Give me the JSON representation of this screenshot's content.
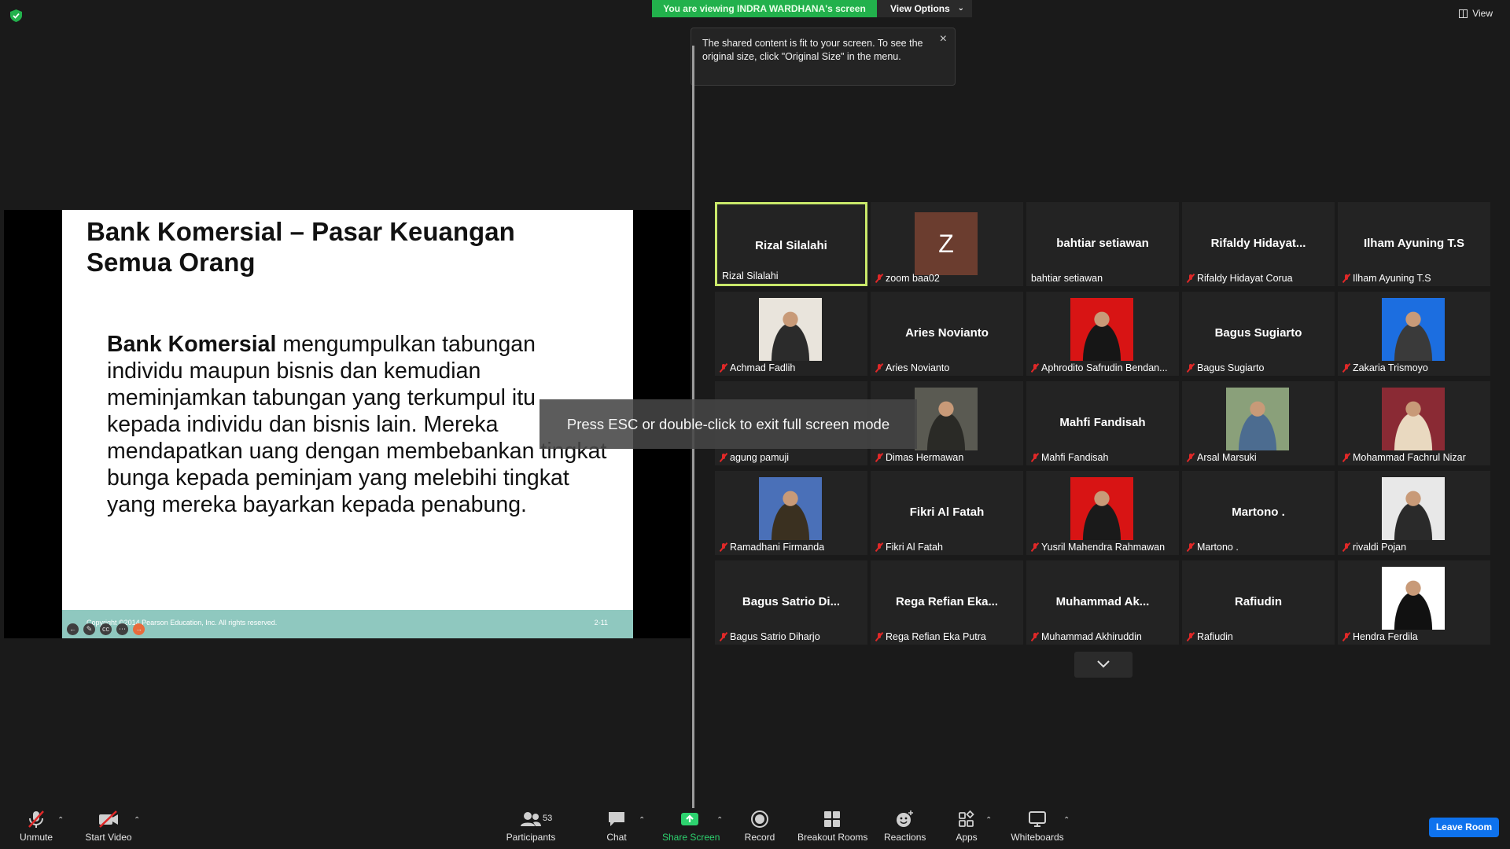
{
  "banner": {
    "viewing_text": "You are viewing INDRA WARDHANA's screen",
    "view_options_label": "View Options",
    "view_label": "View"
  },
  "tooltip": {
    "text": "The shared content is fit to your screen. To see the original size, click \"Original Size\" in the menu."
  },
  "slide": {
    "title": "Bank Komersial – Pasar Keuangan Semua Orang",
    "body_bold": "Bank Komersial",
    "body_rest": " mengumpulkan tabungan individu maupun bisnis dan kemudian meminjamkan tabungan yang terkumpul itu kepada individu dan bisnis lain. Mereka mendapatkan uang dengan membebankan tingkat bunga kepada peminjam yang melebihi tingkat yang mereka bayarkan kepada penabung.",
    "copyright": "Copyright ©2014 Pearson Education, Inc. All rights reserved.",
    "slide_number": "2-11"
  },
  "esc_message": "Press ESC or double-click to exit full screen mode",
  "participants": [
    {
      "display": "Rizal Silalahi",
      "label": "Rizal Silalahi",
      "muted": false,
      "type": "name",
      "active": true
    },
    {
      "display": "Z",
      "label": "zoom baa02",
      "muted": true,
      "type": "avatar"
    },
    {
      "display": "bahtiar setiawan",
      "label": "bahtiar setiawan",
      "muted": false,
      "type": "name"
    },
    {
      "display": "Rifaldy  Hidayat...",
      "label": "Rifaldy Hidayat Corua",
      "muted": true,
      "type": "name"
    },
    {
      "display": "Ilham Ayuning T.S",
      "label": "Ilham Ayuning T.S",
      "muted": true,
      "type": "name"
    },
    {
      "display": "",
      "label": "Achmad Fadlih",
      "muted": true,
      "type": "photo",
      "colors": [
        "#e9e4dc",
        "#2b2b2b"
      ]
    },
    {
      "display": "Aries Novianto",
      "label": "Aries Novianto",
      "muted": true,
      "type": "name"
    },
    {
      "display": "",
      "label": "Aphrodito Safrudin Bendan...",
      "muted": true,
      "type": "photo",
      "colors": [
        "#d81414",
        "#161616"
      ]
    },
    {
      "display": "Bagus Sugiarto",
      "label": "Bagus Sugiarto",
      "muted": true,
      "type": "name"
    },
    {
      "display": "",
      "label": "Zakaria Trismoyo",
      "muted": true,
      "type": "photo",
      "colors": [
        "#1c6ee0",
        "#3a3a3a"
      ]
    },
    {
      "display": "",
      "label": "agung pamuji",
      "muted": true,
      "type": "blank"
    },
    {
      "display": "",
      "label": "Dimas Hermawan",
      "muted": true,
      "type": "photo",
      "colors": [
        "#5a5a52",
        "#2a2a26"
      ]
    },
    {
      "display": "Mahfi Fandisah",
      "label": "Mahfi Fandisah",
      "muted": true,
      "type": "name"
    },
    {
      "display": "",
      "label": "Arsal Marsuki",
      "muted": true,
      "type": "photo",
      "colors": [
        "#8aa07a",
        "#4c6c90"
      ]
    },
    {
      "display": "",
      "label": "Mohammad Fachrul Nizar",
      "muted": true,
      "type": "photo",
      "colors": [
        "#8a2a34",
        "#e9d9c0"
      ]
    },
    {
      "display": "",
      "label": "Ramadhani Firmanda",
      "muted": true,
      "type": "photo",
      "colors": [
        "#4a70b8",
        "#3a3020"
      ]
    },
    {
      "display": "Fikri Al Fatah",
      "label": "Fikri Al Fatah",
      "muted": true,
      "type": "name"
    },
    {
      "display": "",
      "label": "Yusril Mahendra Rahmawan",
      "muted": true,
      "type": "photo",
      "colors": [
        "#d81414",
        "#1a1a1a"
      ]
    },
    {
      "display": "Martono .",
      "label": "Martono .",
      "muted": true,
      "type": "name"
    },
    {
      "display": "",
      "label": "rivaldi Pojan",
      "muted": true,
      "type": "photo",
      "colors": [
        "#e8e8e8",
        "#2a2a2a"
      ]
    },
    {
      "display": "Bagus Satrio  Di...",
      "label": "Bagus Satrio Diharjo",
      "muted": true,
      "type": "name"
    },
    {
      "display": "Rega Refian Eka...",
      "label": "Rega Refian Eka Putra",
      "muted": true,
      "type": "name"
    },
    {
      "display": "Muhammad  Ak...",
      "label": "Muhammad Akhiruddin",
      "muted": true,
      "type": "name"
    },
    {
      "display": "Rafiudin",
      "label": "Rafiudin",
      "muted": true,
      "type": "name"
    },
    {
      "display": "",
      "label": "Hendra Ferdila",
      "muted": true,
      "type": "photo",
      "colors": [
        "#ffffff",
        "#111111"
      ]
    }
  ],
  "toolbar": {
    "unmute": "Unmute",
    "start_video": "Start Video",
    "participants": "Participants",
    "participants_count": "53",
    "chat": "Chat",
    "share_screen": "Share Screen",
    "record": "Record",
    "breakout_rooms": "Breakout Rooms",
    "reactions": "Reactions",
    "apps": "Apps",
    "whiteboards": "Whiteboards",
    "leave": "Leave Room"
  },
  "colors": {
    "banner_green": "#22b14c",
    "active_speaker": "#c9e86a",
    "leave_blue": "#0e72ed",
    "share_green": "#2dd36f",
    "slide_footer": "#8fc8bf"
  }
}
